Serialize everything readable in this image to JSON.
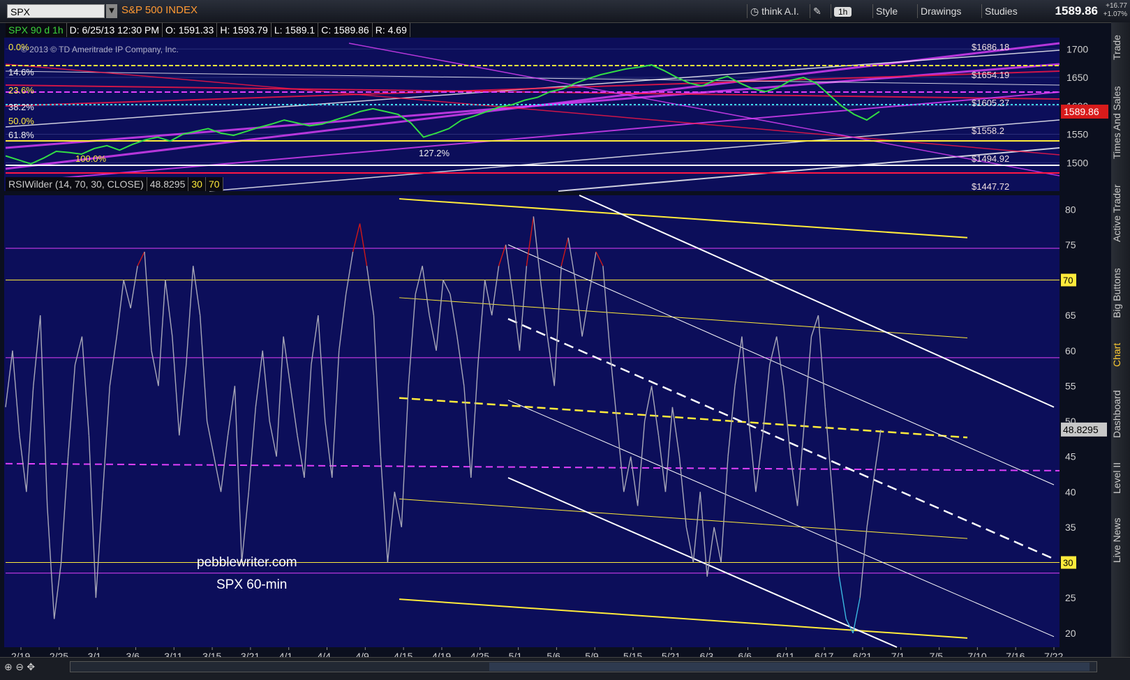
{
  "toolbar": {
    "symbol": "SPX",
    "symbol_name": "S&P 500 INDEX",
    "think_ai": "think A.I.",
    "interval": "1h",
    "style": "Style",
    "drawings": "Drawings",
    "studies": "Studies",
    "last_price": "1589.86",
    "change": "+16.77",
    "change_pct": "+1.07%"
  },
  "infobar": {
    "title": "SPX 90 d 1h",
    "date": "D: 6/25/13 12:30 PM",
    "open": "O: 1591.33",
    "high": "H: 1593.79",
    "low": "L: 1589.1",
    "close": "C: 1589.86",
    "range": "R: 4.69",
    "copyright": "© 2013 © TD Ameritrade IP Company, Inc."
  },
  "rsibar": {
    "study": "RSIWilder (14, 70, 30, CLOSE)",
    "value": "48.8295",
    "ob": "30",
    "os": "70"
  },
  "watermark": {
    "line1": "pebblewriter.com",
    "line2": "SPX 60-min"
  },
  "sidebar": [
    "Trade",
    "Times And Sales",
    "Active Trader",
    "Big Buttons",
    "Chart",
    "Dashboard",
    "Level II",
    "Live News"
  ],
  "colors": {
    "bg": "#0b0f1e",
    "panel": "#0c0e5a",
    "rsi": "#a8a8b8",
    "overbought": "#d01818",
    "oversold": "#3ab8e0",
    "yellow": "#ffeb3b",
    "magenta": "#e040fb",
    "white": "#ffffff",
    "red": "#ff1744"
  },
  "chart_data": [
    {
      "type": "line",
      "title": "SPX 90 d 1h",
      "ylim": [
        1450,
        1720
      ],
      "yticks": [
        1500,
        1550,
        1600,
        1650,
        1700
      ],
      "price_label": "1589.86",
      "fib_labels": [
        "0.0%",
        "14.6%",
        "23.6%",
        "38.2%",
        "50.0%",
        "61.8%",
        "100.0%",
        "127.2%"
      ],
      "price_levels": [
        "1686.18",
        "1654.19",
        "1605.27",
        "1558.2",
        "1494.92",
        "1447.72"
      ],
      "series": [
        {
          "values": [
            1512,
            1505,
            1498,
            1508,
            1520,
            1518,
            1515,
            1525,
            1530,
            1522,
            1532,
            1540,
            1545,
            1538,
            1550,
            1555,
            1560,
            1552,
            1548,
            1555,
            1562,
            1568,
            1575,
            1570,
            1565,
            1568,
            1575,
            1582,
            1590,
            1595,
            1590,
            1585,
            1570,
            1545,
            1552,
            1560,
            1575,
            1582,
            1590,
            1598,
            1602,
            1610,
            1615,
            1625,
            1630,
            1640,
            1648,
            1655,
            1660,
            1665,
            1668,
            1672,
            1662,
            1650,
            1640,
            1635,
            1645,
            1652,
            1640,
            1630,
            1625,
            1632,
            1645,
            1650,
            1640,
            1620,
            1600,
            1585,
            1575,
            1590
          ]
        }
      ]
    },
    {
      "type": "line",
      "title": "RSIWilder (14, 70, 30, CLOSE)",
      "ylim": [
        18,
        82
      ],
      "yticks": [
        20,
        25,
        30,
        35,
        40,
        45,
        50,
        55,
        60,
        65,
        70,
        75,
        80
      ],
      "overbought": 70,
      "oversold": 30,
      "current": 48.8295,
      "xticks": [
        "2/19",
        "2/25",
        "3/1",
        "3/6",
        "3/11",
        "3/15",
        "3/21",
        "4/1",
        "4/4",
        "4/9",
        "4/15",
        "4/19",
        "4/25",
        "5/1",
        "5/6",
        "5/9",
        "5/15",
        "5/21",
        "6/3",
        "6/6",
        "6/11",
        "6/17",
        "6/21",
        "7/1",
        "7/5",
        "7/10",
        "7/16",
        "7/22"
      ],
      "series": [
        {
          "values": [
            52,
            60,
            48,
            40,
            55,
            65,
            38,
            22,
            30,
            45,
            58,
            62,
            48,
            25,
            40,
            55,
            62,
            70,
            66,
            72,
            74,
            60,
            55,
            70,
            62,
            48,
            58,
            72,
            65,
            50,
            45,
            40,
            48,
            55,
            30,
            40,
            52,
            60,
            50,
            45,
            62,
            55,
            48,
            42,
            58,
            65,
            50,
            42,
            60,
            68,
            74,
            78,
            72,
            65,
            45,
            30,
            40,
            35,
            55,
            68,
            72,
            65,
            60,
            70,
            68,
            62,
            55,
            42,
            58,
            70,
            65,
            72,
            75,
            68,
            60,
            72,
            79,
            70,
            62,
            55,
            72,
            76,
            70,
            62,
            68,
            74,
            72,
            60,
            50,
            40,
            45,
            38,
            50,
            55,
            48,
            40,
            52,
            45,
            35,
            30,
            40,
            28,
            35,
            30,
            45,
            55,
            62,
            50,
            40,
            48,
            58,
            62,
            55,
            45,
            38,
            50,
            62,
            65,
            52,
            40,
            28,
            22,
            20,
            25,
            35,
            42,
            48.8
          ]
        }
      ]
    }
  ]
}
